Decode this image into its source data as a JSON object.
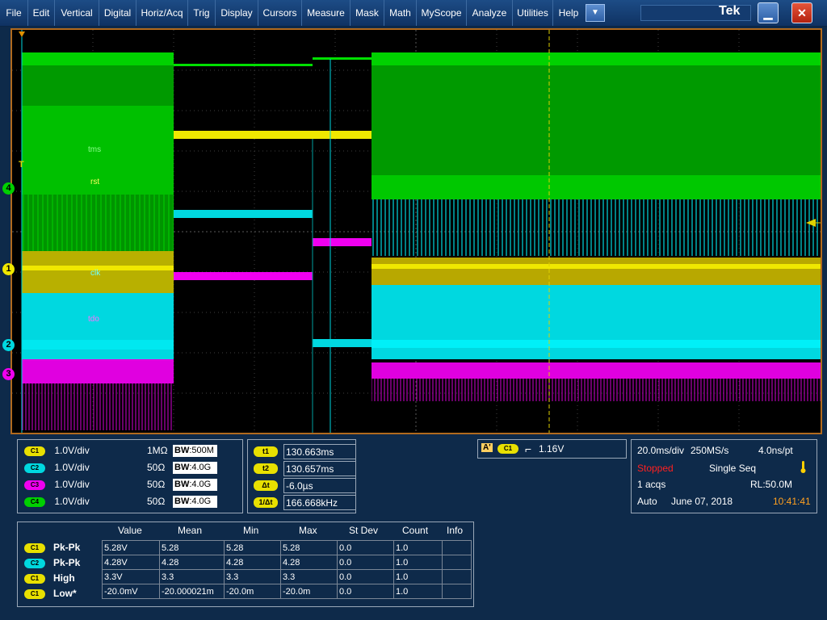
{
  "menu": {
    "items": [
      "File",
      "Edit",
      "Vertical",
      "Digital",
      "Horiz/Acq",
      "Trig",
      "Display",
      "Cursors",
      "Measure",
      "Mask",
      "Math",
      "MyScope",
      "Analyze",
      "Utilities",
      "Help"
    ],
    "dropdown_glyph": "▼",
    "brand": "Tek",
    "minimize_glyph": "▁",
    "close_glyph": "✕"
  },
  "scope": {
    "channel_markers": [
      "4",
      "1",
      "2",
      "3"
    ],
    "trigger_marker": "T",
    "wave_labels": [
      "tms",
      "rst",
      "clk",
      "tdo"
    ],
    "colors": {
      "ch1": "#f0e800",
      "ch2": "#00e0e8",
      "ch3": "#ff00ff",
      "ch4": "#00d200",
      "cursor": "#e0d000",
      "frame": "#b16a1e"
    }
  },
  "vertical": {
    "channels": [
      {
        "chip": "C1",
        "scale": "1.0V/div",
        "impedance": "1MΩ",
        "bw_prefix": "BW",
        "bandwidth": ":500M",
        "color": "#e8e000"
      },
      {
        "chip": "C2",
        "scale": "1.0V/div",
        "impedance": "50Ω",
        "bw_prefix": "BW",
        "bandwidth": ":4.0G",
        "color": "#00d8e0"
      },
      {
        "chip": "C3",
        "scale": "1.0V/div",
        "impedance": "50Ω",
        "bw_prefix": "BW",
        "bandwidth": ":4.0G",
        "color": "#f000f0"
      },
      {
        "chip": "C4",
        "scale": "1.0V/div",
        "impedance": "50Ω",
        "bw_prefix": "BW",
        "bandwidth": ":4.0G",
        "color": "#00d000"
      }
    ]
  },
  "cursors": [
    {
      "label": "t1",
      "value": "130.663ms"
    },
    {
      "label": "t2",
      "value": "130.657ms"
    },
    {
      "label": "Δt",
      "value": "-6.0µs"
    },
    {
      "label": "1/Δt",
      "value": "166.668kHz"
    }
  ],
  "trigger": {
    "source_letter": "A'",
    "chip": "C1",
    "slope_glyph": "⌐",
    "level": "1.16V"
  },
  "acquisition": {
    "timebase": "20.0ms/div",
    "sample_rate": "250MS/s",
    "resolution": "4.0ns/pt",
    "status": "Stopped",
    "mode": "Single Seq",
    "acqs": "1 acqs",
    "record_length": "RL:50.0M",
    "trigger_mode": "Auto",
    "date": "June 07, 2018",
    "time": "10:41:41"
  },
  "measurements": {
    "headers": [
      "Value",
      "Mean",
      "Min",
      "Max",
      "St Dev",
      "Count",
      "Info"
    ],
    "rows": [
      {
        "chip": "C1",
        "color": "#e8e000",
        "name": "Pk-Pk",
        "cells": [
          "5.28V",
          "5.28",
          "5.28",
          "5.28",
          "0.0",
          "1.0",
          ""
        ]
      },
      {
        "chip": "C2",
        "color": "#00d8e0",
        "name": "Pk-Pk",
        "cells": [
          "4.28V",
          "4.28",
          "4.28",
          "4.28",
          "0.0",
          "1.0",
          ""
        ]
      },
      {
        "chip": "C1",
        "color": "#e8e000",
        "name": "High",
        "cells": [
          "3.3V",
          "3.3",
          "3.3",
          "3.3",
          "0.0",
          "1.0",
          ""
        ]
      },
      {
        "chip": "C1",
        "color": "#e8e000",
        "name": "Low*",
        "cells": [
          "-20.0mV",
          "-20.000021m",
          "-20.0m",
          "-20.0m",
          "0.0",
          "1.0",
          ""
        ]
      }
    ]
  }
}
